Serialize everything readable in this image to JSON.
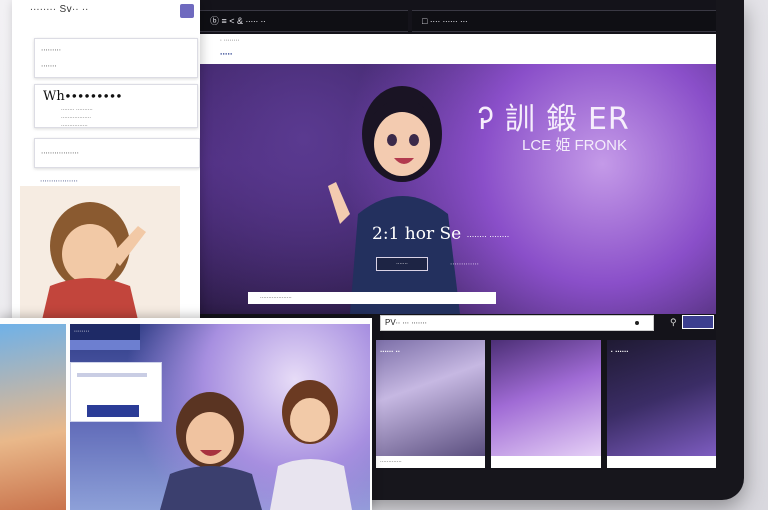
{
  "main": {
    "topbar": {
      "left": "ⓑ ≡  <   & ∙∙∙∙∙  ∙∙",
      "right": "□ ∙∙∙∙ ∙∙∙∙∙∙ ∙∙∙"
    },
    "subbar": {
      "small": "∙ ∙∙∙∙∙∙∙∙",
      "brand": "∙∙∙∙∙"
    },
    "hero": {
      "title": "Ꭾ 訓 鍛 ER",
      "subtitle": "LCE 姫 FRONK",
      "tagline": "2:1 hor Se",
      "tagline_small": "∙∙∙∙∙∙∙∙ ∙∙∙∙∙∙∙∙",
      "cta": "∙∙∙∙∙∙∙",
      "cta_link": "∙∙∙∙∙∙∙∙∙∙∙∙∙"
    },
    "info_strip": "∙∙∙∙∙∙∙∙∙∙∙∙∙∙∙∙∙∙∙",
    "search": {
      "label": "PV∙∙ ∙∙∙ ∙∙∙∙∙∙∙"
    },
    "cards": [
      {
        "label": "∙∙∙∙∙∙ ∙∙",
        "foot": "∙∙∙∙∙∙∙∙∙∙∙∙∙"
      },
      {
        "label": "",
        "foot": ""
      },
      {
        "label": "∙ ∙∙∙∙∙∙",
        "foot": ""
      }
    ]
  },
  "sidebar": {
    "title": "∙∙∙∙∙∙∙∙ Sv∙∙ ∙∙",
    "row1": "∙∙∙∙∙∙∙∙∙",
    "row2": "∙∙∙∙∙∙∙",
    "heading": "Wh∙∙∙∙∙∙∙∙∙",
    "line1": "∙∙∙∙∙∙∙∙ ∙∙∙∙∙∙∙∙∙∙",
    "line2": "∙∙∙∙∙∙∙∙∙∙∙∙∙∙∙∙∙∙",
    "line3": "∙∙∙∙∙∙∙∙∙∙∙∙∙∙∙∙",
    "input": "∙∙∙∙∙∙∙∙∙∙∙∙∙∙∙∙∙",
    "link": "∙∙∙∙∙∙∙∙∙∙∙∙∙∙∙∙∙"
  },
  "collage": {
    "nav": "∙∙∙∙∙∙∙∙"
  }
}
